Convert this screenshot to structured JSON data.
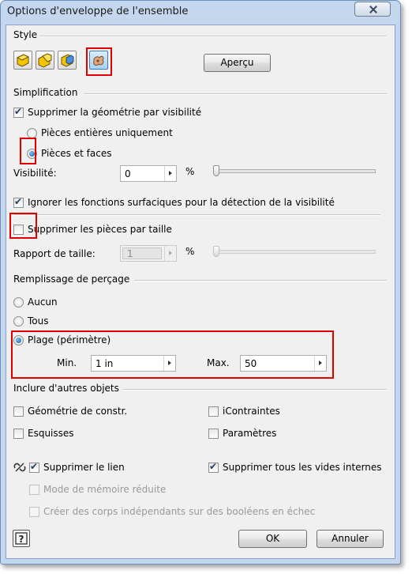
{
  "window": {
    "title": "Options d'enveloppe de l'ensemble"
  },
  "style": {
    "section_label": "Style",
    "style_icons": [
      "style-1-icon",
      "style-2-icon",
      "style-3-icon",
      "style-4-icon"
    ],
    "preview_button": "Aperçu"
  },
  "simplification": {
    "section_label": "Simplification",
    "remove_by_visibility": {
      "label": "Supprimer la géométrie par visibilité",
      "checked": true
    },
    "whole_parts_only": {
      "label": "Pièces entières uniquement",
      "selected": false
    },
    "parts_and_faces": {
      "label": "Pièces et faces",
      "selected": true
    },
    "visibility": {
      "label": "Visibilité:",
      "value": "0",
      "unit": "%",
      "slider_level": 0
    },
    "ignore_surface": {
      "label": "Ignorer les fonctions surfaciques pour la détection de la visibilité",
      "checked": true
    },
    "remove_by_size": {
      "label": "Supprimer les pièces par taille",
      "checked": false
    },
    "size_ratio": {
      "label": "Rapport de taille:",
      "value": "1",
      "unit": "%",
      "slider_level": 0
    }
  },
  "hole_fill": {
    "section_label": "Remplissage de perçage",
    "none": {
      "label": "Aucun",
      "selected": false
    },
    "all": {
      "label": "Tous",
      "selected": false
    },
    "range": {
      "label": "Plage (périmètre)",
      "selected": true
    },
    "min": {
      "label": "Min.",
      "value": "1 in"
    },
    "max": {
      "label": "Max.",
      "value": "50"
    }
  },
  "include": {
    "section_label": "Inclure d'autres objets",
    "construction_geometry": {
      "label": "Géométrie de constr.",
      "checked": false
    },
    "constraints": {
      "label": "iContraintes",
      "checked": false
    },
    "sketches": {
      "label": "Esquisses",
      "checked": false
    },
    "parameters": {
      "label": "Paramètres",
      "checked": false
    }
  },
  "bottom": {
    "remove_link": {
      "label": "Supprimer le lien",
      "checked": true
    },
    "remove_internal_voids": {
      "label": "Supprimer tous les vides internes",
      "checked": true
    },
    "reduced_memory": {
      "label": "Mode de mémoire réduite",
      "checked": false,
      "enabled": false
    },
    "independent_bodies": {
      "label": "Créer des corps indépendants sur des booléens en échec",
      "checked": false,
      "enabled": false
    }
  },
  "footer": {
    "help_icon": "help-icon",
    "ok": "OK",
    "cancel": "Annuler"
  },
  "colors": {
    "highlight": "#e00000",
    "title_bar": "#c4d7ee",
    "client_bg": "#f0f0f0"
  }
}
